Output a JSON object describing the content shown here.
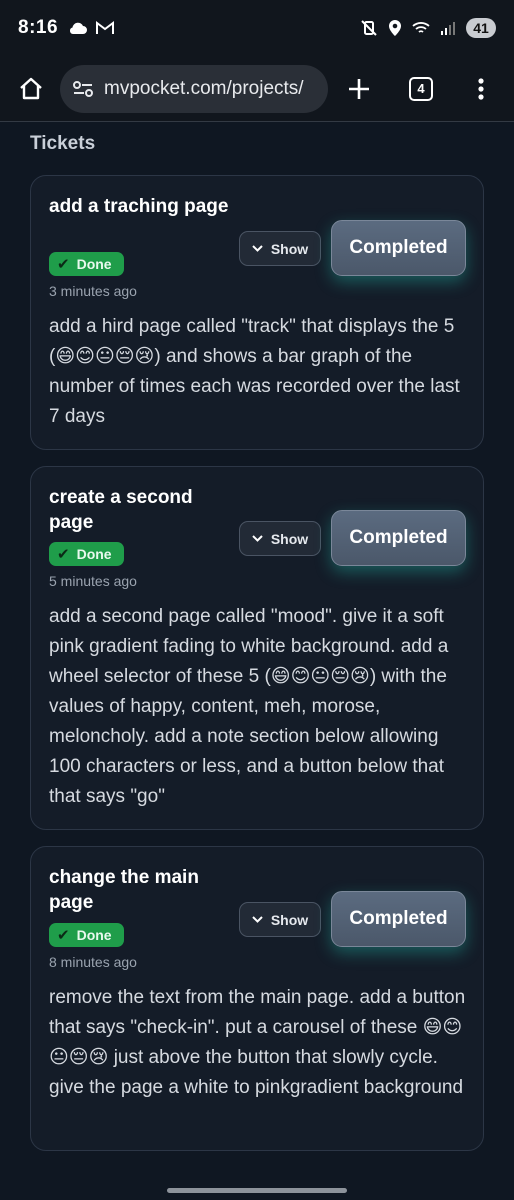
{
  "status_bar": {
    "time": "8:16",
    "battery": "41",
    "left_icons": [
      "cloud-icon",
      "gmail-icon"
    ],
    "right_icons": [
      "mute-vibrate-icon",
      "location-icon",
      "wifi-icon",
      "signal-icon"
    ]
  },
  "browser": {
    "url": "mvpocket.com/projects/",
    "tab_count": "4"
  },
  "section_title": "Tickets",
  "tickets": [
    {
      "title": "add a traching page",
      "status": "Done",
      "time_ago": "3 minutes ago",
      "show_label": "Show",
      "completed_label": "Completed",
      "description": "add a hird page called \"track\" that displays the 5 (😄😊😐😔😢) and shows a bar graph of the number of times each was recorded over the last 7 days"
    },
    {
      "title": "create a second page",
      "status": "Done",
      "time_ago": "5 minutes ago",
      "show_label": "Show",
      "completed_label": "Completed",
      "description": "add a second page called \"mood\". give it a soft pink gradient fading to white background. add a wheel selector of these 5 (😄😊😐😔😢) with the values of happy, content, meh, morose, meloncholy. add a note section below allowing 100 characters or less, and a button below that that says \"go\""
    },
    {
      "title": "change the main page",
      "status": "Done",
      "time_ago": "8 minutes ago",
      "show_label": "Show",
      "completed_label": "Completed",
      "description": "remove the text from the main page. add a button that says \"check-in\". put a carousel of these 😄😊😐😔😢 just above the button that slowly cycle. give the page a white to pinkgradient background"
    }
  ]
}
